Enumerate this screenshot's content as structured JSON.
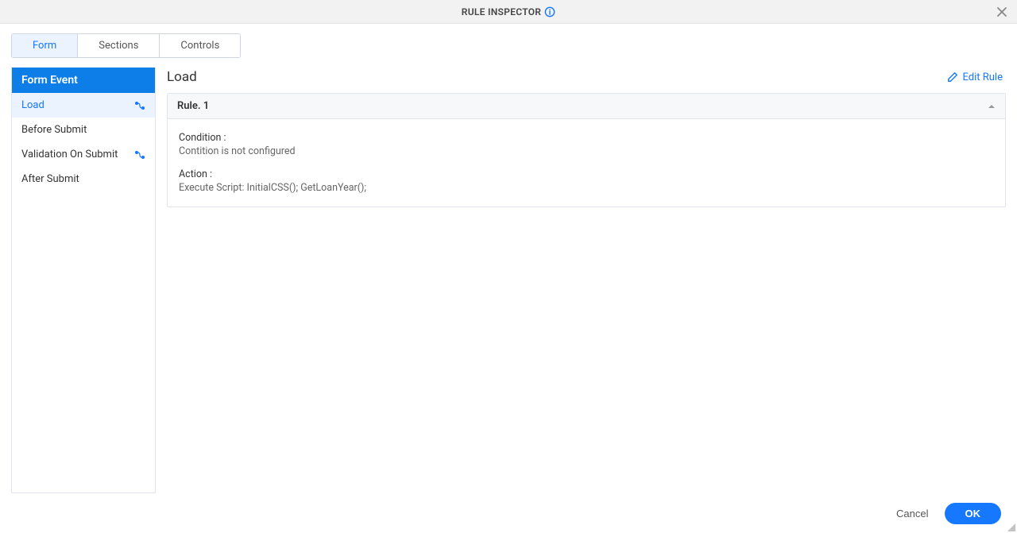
{
  "header": {
    "title": "RULE INSPECTOR"
  },
  "tabs": {
    "form": "Form",
    "sections": "Sections",
    "controls": "Controls"
  },
  "sidebar": {
    "header": "Form Event",
    "items": [
      {
        "label": "Load",
        "hasFlow": true,
        "selected": true
      },
      {
        "label": "Before Submit",
        "hasFlow": false,
        "selected": false
      },
      {
        "label": "Validation On Submit",
        "hasFlow": true,
        "selected": false
      },
      {
        "label": "After Submit",
        "hasFlow": false,
        "selected": false
      }
    ]
  },
  "details": {
    "title": "Load",
    "editRuleLabel": "Edit Rule",
    "rule": {
      "title": "Rule. 1",
      "conditionLabel": "Condition :",
      "conditionValue": "Contition is not configured",
      "actionLabel": "Action :",
      "actionValue": "Execute Script: InitialCSS(); GetLoanYear();"
    }
  },
  "footer": {
    "cancel": "Cancel",
    "ok": "OK"
  }
}
